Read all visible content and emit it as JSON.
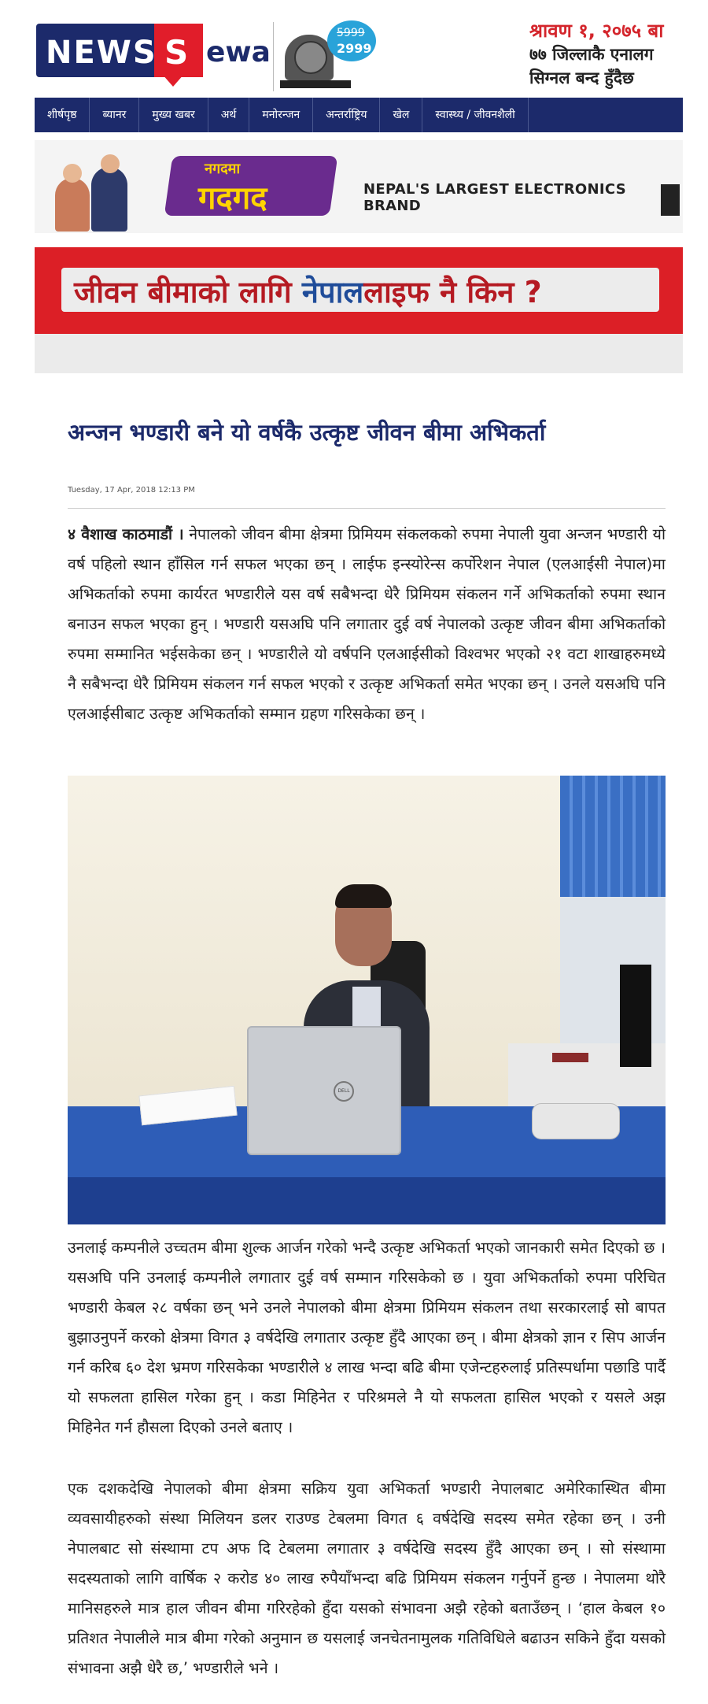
{
  "header": {
    "logo_news": "NEWS",
    "logo_s": "S",
    "logo_ewa": "ewa",
    "tv_ad": {
      "old_price": "5999",
      "new_price": "2999"
    },
    "headline_lines": [
      "श्रावण १, २०७५ बा",
      "७७ जिल्लाकै एनालग",
      "सिग्नल बन्द हुँदैछ"
    ]
  },
  "nav": {
    "items": [
      "शीर्षपृष्ठ",
      "ब्यानर",
      "मुख्य खबर",
      "अर्थ",
      "मनोरन्जन",
      "अन्तर्राष्ट्रिय",
      "खेल",
      "स्वास्थ्य / जीवनशैली"
    ]
  },
  "ads": {
    "electronics": {
      "logo_top": "नगदमा",
      "logo_main": "गदगद",
      "brand_line": "NEPAL'S LARGEST ELECTRONICS BRAND"
    },
    "life_insurance": {
      "part1": "जीवन बीमाको लागि ",
      "part2": "नेपाल",
      "part3": "लाइफ",
      "part4": " नै किन ?"
    }
  },
  "article": {
    "title": "अन्जन भण्डारी बने यो वर्षकै उत्कृष्ट जीवन बीमा अभिकर्ता",
    "date": "Tuesday, 17 Apr, 2018 12:13 PM",
    "dateline": "४ वैशाख काठमाडौं ।",
    "p1": "नेपालको जीवन बीमा क्षेत्रमा प्रिमियम संकलकको रुपमा नेपाली युवा अन्जन भण्डारी यो वर्ष पहिलो स्थान हाँसिल गर्न सफल भएका छन् । लाईफ इन्स्योरेन्स कर्पोरेशन नेपाल (एलआईसी नेपाल)मा अभिकर्ताको रुपमा कार्यरत भण्डारीले यस वर्ष सबैभन्दा धेरै प्रिमियम संकलन गर्ने अभिकर्ताको रुपमा स्थान बनाउन सफल भएका हुन् । भण्डारी यसअघि पनि लगातार दुई वर्ष नेपालको उत्कृष्ट जीवन बीमा अभिकर्ताको रुपमा सम्मानित भईसकेका छन् । भण्डारीले यो वर्षपनि एलआईसीको विश्वभर भएको २१ वटा शाखाहरुमध्ये नै सबैभन्दा धेरै प्रिमियम संकलन गर्न सफल भएको र उत्कृष्ट अभिकर्ता समेत भएका छन् । उनले यसअघि पनि एलआईसीबाट उत्कृष्ट अभिकर्ताको सम्मान ग्रहण गरिसकेका छन् ।",
    "photo_laptop_logo": "DELL",
    "p2": "उनलाई कम्पनीले उच्चतम बीमा शुल्क आर्जन गरेको भन्दै उत्कृष्ट अभिकर्ता भएको जानकारी समेत दिएको छ । यसअघि पनि उनलाई कम्पनीले लगातार दुई वर्ष सम्मान गरिसकेको छ । युवा अभिकर्ताको रुपमा परिचित भण्डारी केबल २८ वर्षका छन् भने उनले नेपालको बीमा क्षेत्रमा प्रिमियम संकलन तथा सरकारलाई सो बापत बुझाउनुपर्ने करको क्षेत्रमा विगत ३ वर्षदेखि लगातार उत्कृष्ट हुँदै आएका छन् । बीमा क्षेत्रको ज्ञान र सिप आर्जन गर्न करिब ६० देश भ्रमण गरिसकेका भण्डारीले ४ लाख भन्दा बढि बीमा एजेन्टहरुलाई प्रतिस्पर्धामा पछाडि पार्दै यो सफलता हासिल गरेका हुन् । कडा मिहिनेत र परिश्रमले नै यो सफलता हासिल भएको र यसले अझ मिहिनेत गर्न हौसला दिएको उनले बताए ।",
    "p3": "एक दशकदेखि नेपालको बीमा क्षेत्रमा सक्रिय युवा अभिकर्ता भण्डारी नेपालबाट अमेरिकास्थित बीमा व्यवसायीहरुको संस्था मिलियन डलर राउण्ड टेबलमा विगत ६ वर्षदेखि सदस्य समेत रहेका छन् । उनी नेपालबाट सो संस्थामा टप अफ दि टेबलमा लगातार ३ वर्षदेखि सदस्य हुँदै आएका छन् । सो संस्थामा सदस्यताको लागि वार्षिक २ करोड ४० लाख रुपैयाँभन्दा बढि प्रिमियम संकलन गर्नुपर्ने हुन्छ । नेपालमा थोरै मानिसहरुले मात्र हाल जीवन बीमा गरिरहेको हुँदा यसको संभावना अझै रहेको बताउँछन् । ‘हाल केबल १० प्रतिशत नेपालीले मात्र बीमा गरेको अनुमान छ यसलाई जनचेतनामुलक गतिविधिले बढाउन सकिने हुँदा यसको संभावना अझै धेरै छ,’ भण्डारीले भने ।"
  }
}
